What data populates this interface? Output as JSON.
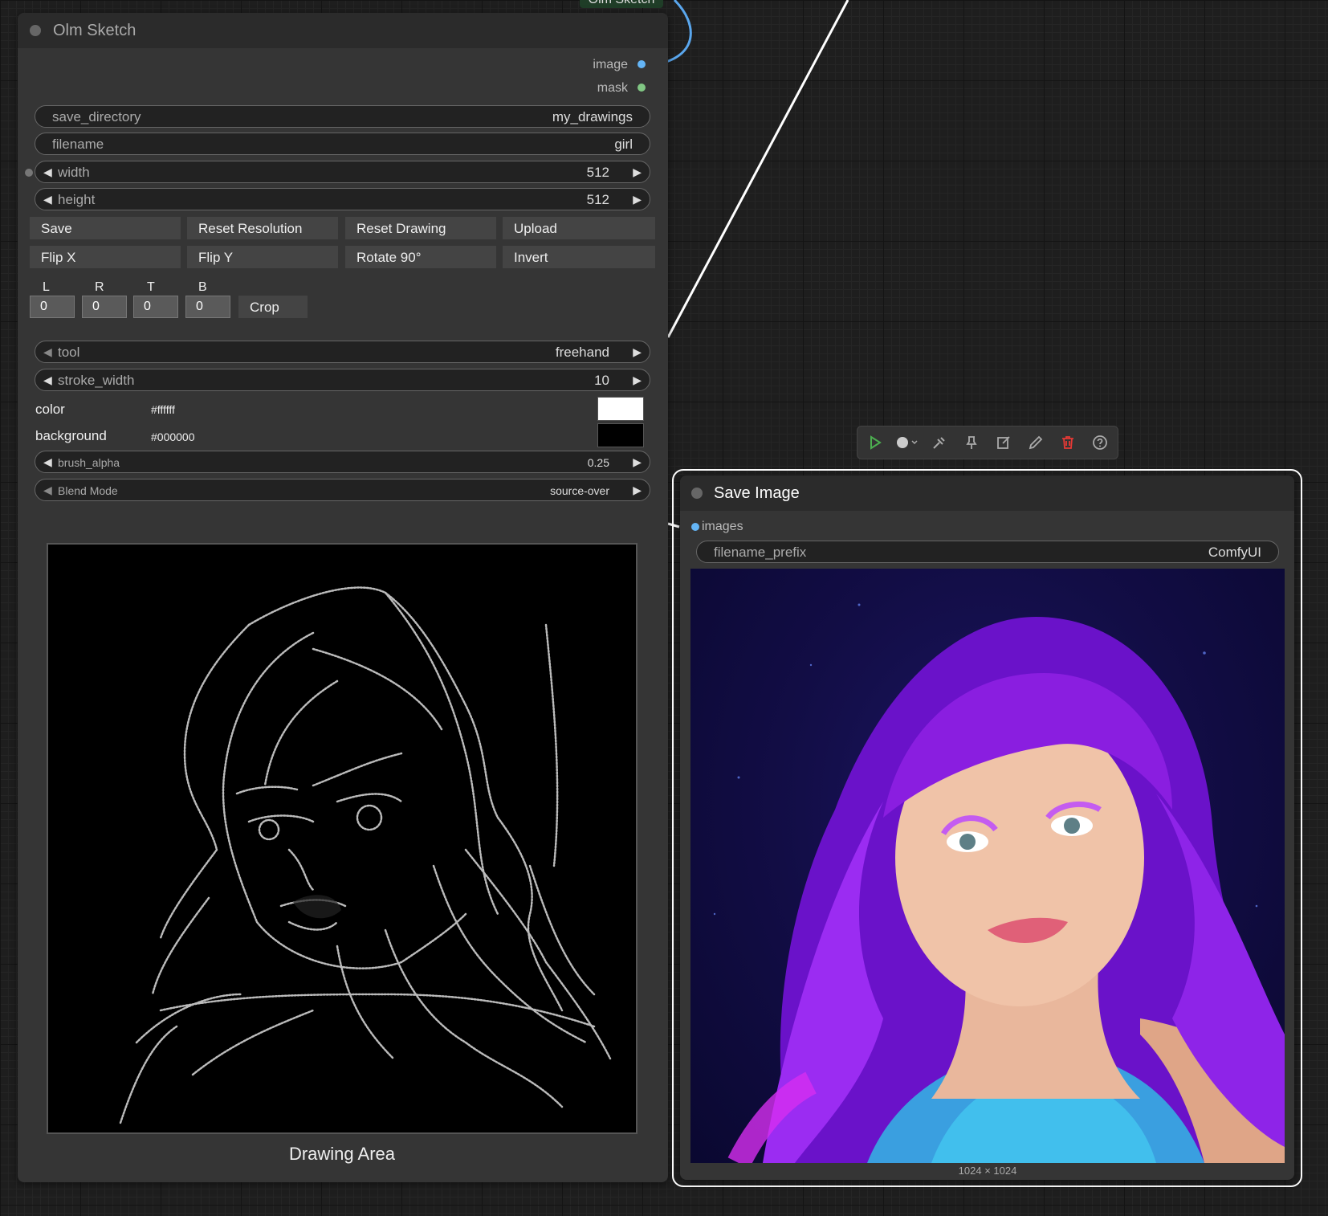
{
  "graph": {
    "offscreen_node_label": "Olm Sketch"
  },
  "sketch_node": {
    "title": "Olm Sketch",
    "outputs": [
      "image",
      "mask"
    ],
    "save_directory": {
      "label": "save_directory",
      "value": "my_drawings"
    },
    "filename": {
      "label": "filename",
      "value": "girl"
    },
    "width": {
      "label": "width",
      "value": "512"
    },
    "height": {
      "label": "height",
      "value": "512"
    },
    "buttons_row1": [
      "Save",
      "Reset Resolution",
      "Reset Drawing",
      "Upload"
    ],
    "buttons_row2": [
      "Flip X",
      "Flip Y",
      "Rotate 90°",
      "Invert"
    ],
    "crop": {
      "labels": [
        "L",
        "R",
        "T",
        "B"
      ],
      "values": [
        "0",
        "0",
        "0",
        "0"
      ],
      "button": "Crop"
    },
    "tool": {
      "label": "tool",
      "value": "freehand"
    },
    "stroke_width": {
      "label": "stroke_width",
      "value": "10"
    },
    "color": {
      "label": "color",
      "value": "#ffffff"
    },
    "background": {
      "label": "background",
      "value": "#000000"
    },
    "brush_alpha": {
      "label": "brush_alpha",
      "value": "0.25"
    },
    "blend_mode": {
      "label": "Blend Mode",
      "value": "source-over"
    },
    "canvas_caption": "Drawing Area"
  },
  "toolbar": {
    "icons": [
      "play-icon",
      "color-dot-icon",
      "bypass-icon",
      "pin-icon",
      "edit-icon",
      "pencil-icon",
      "delete-icon",
      "help-icon"
    ]
  },
  "save_node": {
    "title": "Save Image",
    "input": "images",
    "filename_prefix": {
      "label": "filename_prefix",
      "value": "ComfyUI"
    },
    "image_size": "1024 × 1024"
  },
  "colors": {
    "image_slot": "#64b5f6",
    "mask_slot": "#81c784",
    "selection": "#ffffff",
    "play": "#4caf50",
    "delete": "#e53935"
  }
}
